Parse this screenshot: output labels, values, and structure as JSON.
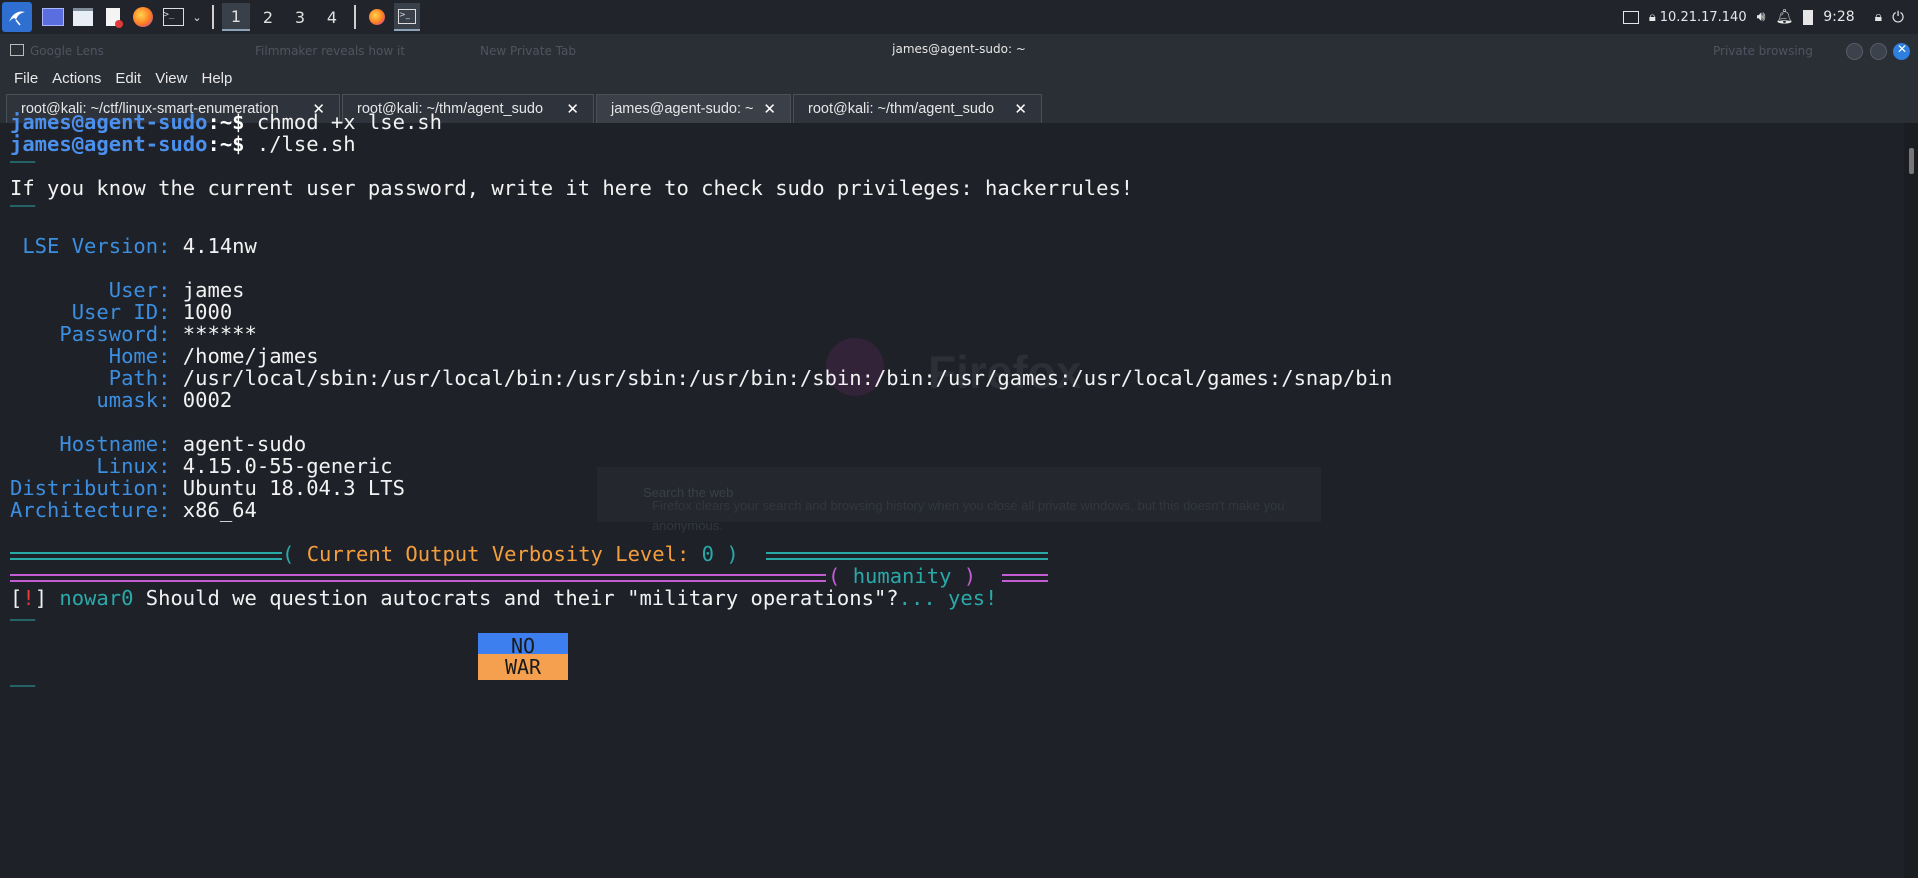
{
  "taskbar": {
    "workspaces": [
      "1",
      "2",
      "3",
      "4"
    ],
    "active_workspace": "1",
    "ip": "10.21.17.140",
    "clock": "9:28",
    "icons": [
      "kali-menu-icon",
      "desktop-icon",
      "file-manager-icon",
      "text-editor-icon",
      "firefox-icon",
      "terminal-icon",
      "chevron-down-icon",
      "firefox-app-icon",
      "terminal-app-icon",
      "display-icon",
      "vpn-lock-icon",
      "volume-icon",
      "bell-icon",
      "battery-icon",
      "lock-icon",
      "power-icon"
    ]
  },
  "window": {
    "title": "james@agent-sudo: ~"
  },
  "ghost": {
    "tab1": "Google Lens",
    "tab2": "Filmmaker reveals how it",
    "tab3": "New Private Tab",
    "private": "Private browsing",
    "firefox": "Firefox",
    "search": "Search the web",
    "notice": "Firefox clears your search and browsing history when you close all private windows, but this doesn't make you anonymous."
  },
  "menu": [
    "File",
    "Actions",
    "Edit",
    "View",
    "Help"
  ],
  "tabs": [
    {
      "label": "root@kali: ~/ctf/linux-smart-enumeration",
      "active": false
    },
    {
      "label": "root@kali: ~/thm/agent_sudo",
      "active": false
    },
    {
      "label": "james@agent-sudo: ~",
      "active": true
    },
    {
      "label": "root@kali: ~/thm/agent_sudo",
      "active": false
    }
  ],
  "terminal": {
    "prompt_user": "james@agent-sudo",
    "prompt_sep": ":~$",
    "cmd1": " chmod +x lse.sh",
    "cmd2": " ./lse.sh",
    "short_rule": "———",
    "sudo_prompt": "If you know the current user password, write it here to check sudo privileges: hackerrules!",
    "version_label": " LSE Version:",
    "version_value": " 4.14nw",
    "info": [
      {
        "label": "        User:",
        "value": " james"
      },
      {
        "label": "     User ID:",
        "value": " 1000"
      },
      {
        "label": "    Password:",
        "value": " ******"
      },
      {
        "label": "        Home:",
        "value": " /home/james"
      },
      {
        "label": "        Path:",
        "value": " /usr/local/sbin:/usr/local/bin:/usr/sbin:/usr/bin:/sbin:/bin:/usr/games:/usr/local/games:/snap/bin"
      },
      {
        "label": "       umask:",
        "value": " 0002"
      },
      {
        "label": "    Hostname:",
        "value": " agent-sudo"
      },
      {
        "label": "       Linux:",
        "value": " 4.15.0-55-generic"
      },
      {
        "label": "Distribution:",
        "value": " Ubuntu 18.04.3 LTS"
      },
      {
        "label": "Architecture:",
        "value": " x86_64"
      }
    ],
    "verbosity_label": "( Current Output Verbosity Level: ",
    "verbosity_value": "0",
    "verbosity_close": " )",
    "section": "( humanity )",
    "check_open": "[",
    "check_mark": "!",
    "check_close": "]",
    "check_id": " nowar0",
    "check_text": " Should we question autocrats and their \"military operations\"?",
    "check_dots": "... ",
    "check_result": "yes!",
    "flag_top": "NO",
    "flag_bottom": "WAR"
  },
  "colors": {
    "prompt": "#4c90ee",
    "label": "#3c8fe0",
    "teal": "#2aa9a9",
    "yellow": "#f59e3d",
    "pink": "#c25cd3",
    "flag_blue": "#3e7fef",
    "flag_orange": "#f4a04e"
  }
}
